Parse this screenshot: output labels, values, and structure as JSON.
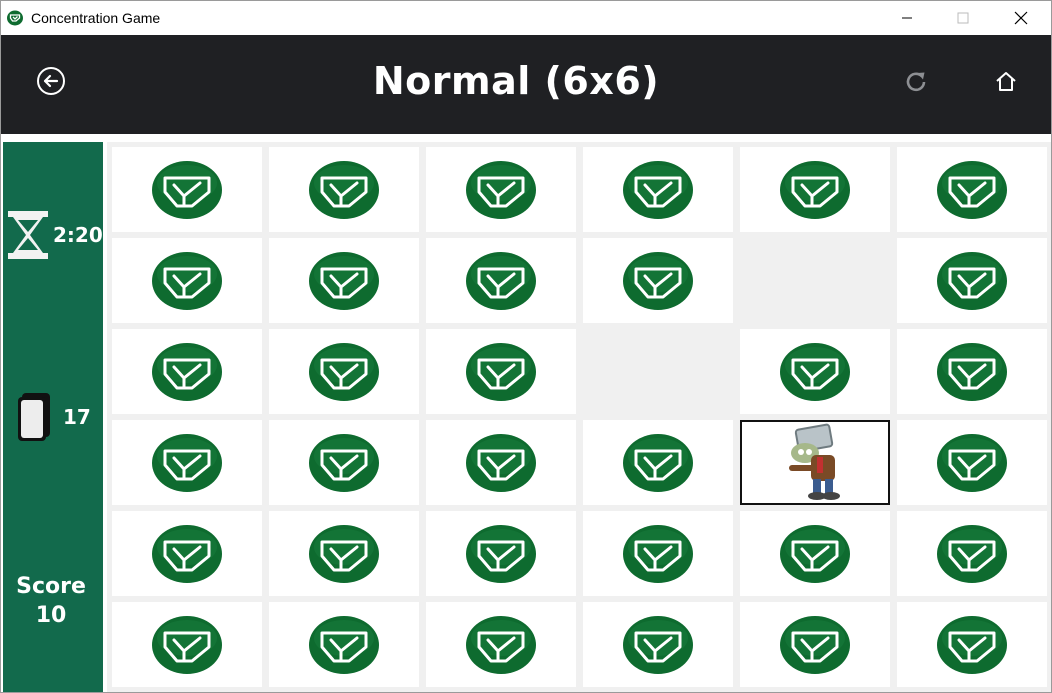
{
  "window": {
    "title": "Concentration Game"
  },
  "header": {
    "title": "Normal (6x6)"
  },
  "sidebar": {
    "timer": "2:20",
    "cards_left": "17",
    "score_label": "Score",
    "score_value": "10"
  },
  "colors": {
    "header_bg": "#1f2023",
    "sidebar_bg": "#126a4c",
    "card_back": "#0e6b2f"
  },
  "board": {
    "rows": 6,
    "cols": 6,
    "tiles": [
      "back",
      "back",
      "back",
      "back",
      "back",
      "back",
      "back",
      "back",
      "back",
      "back",
      "empty",
      "back",
      "back",
      "back",
      "back",
      "empty",
      "back",
      "back",
      "back",
      "back",
      "back",
      "back",
      "zombie",
      "back",
      "back",
      "back",
      "back",
      "back",
      "back",
      "back",
      "back",
      "back",
      "back",
      "back",
      "back",
      "back"
    ]
  }
}
